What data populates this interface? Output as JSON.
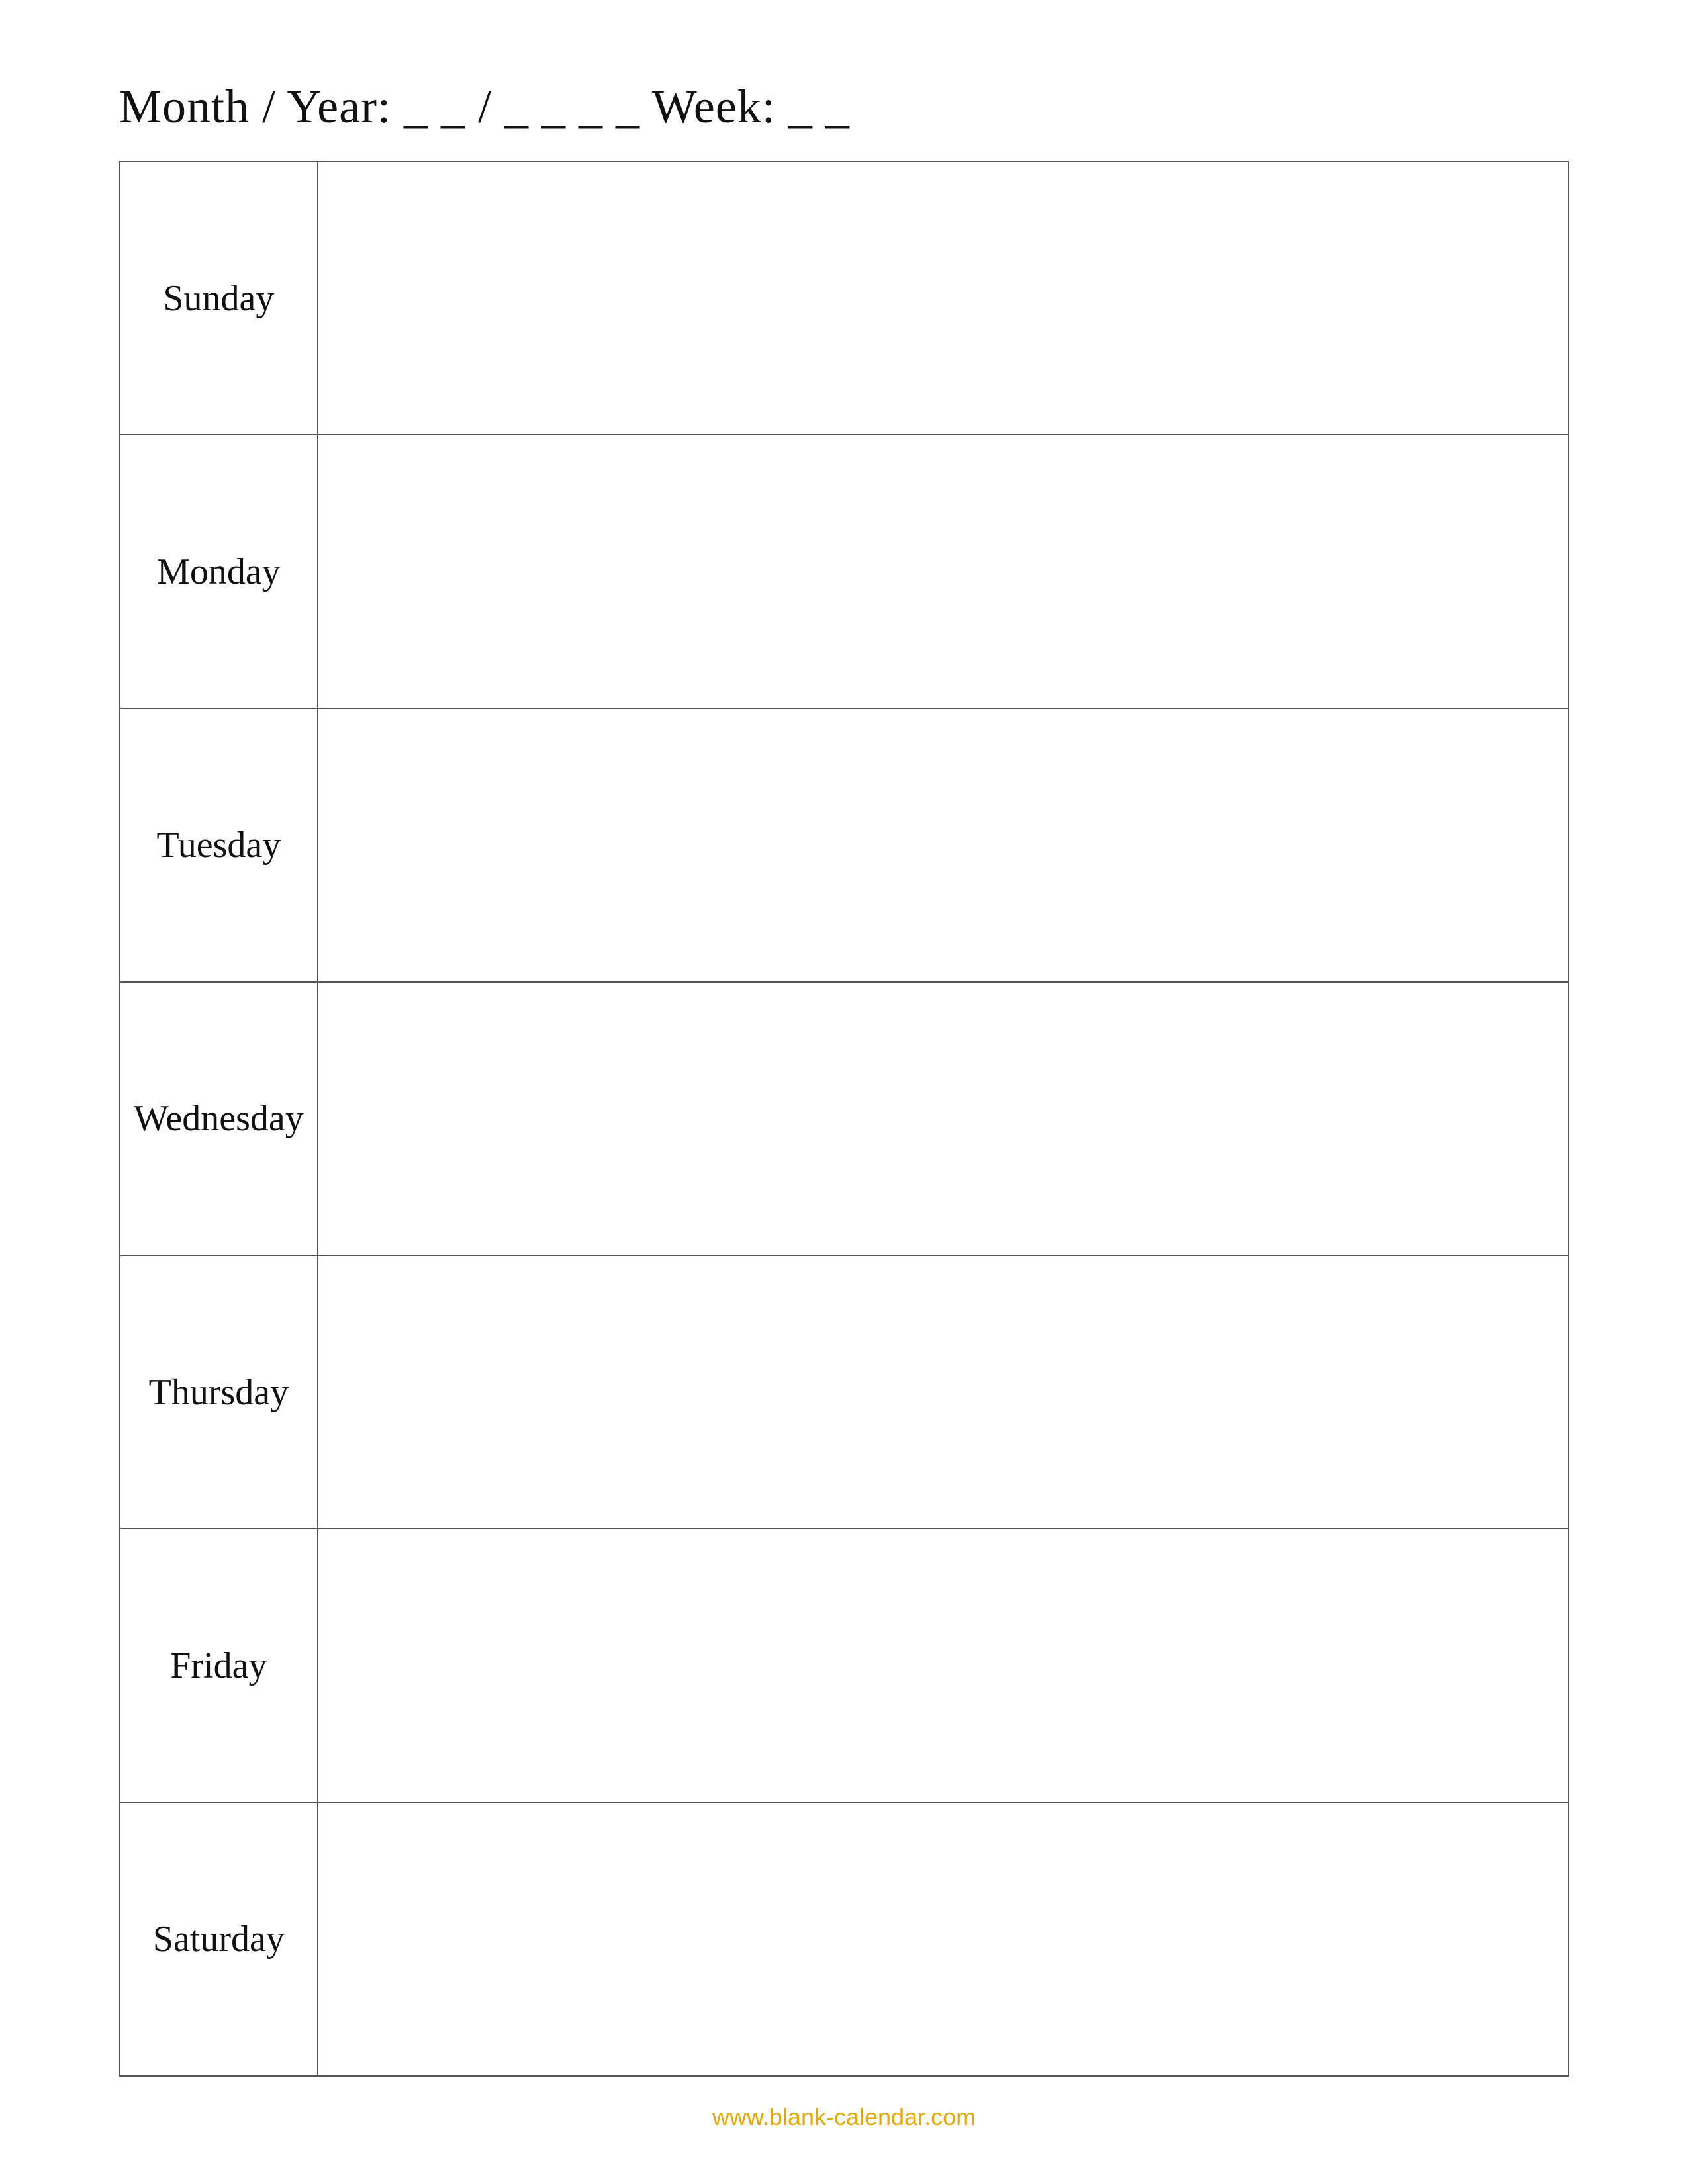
{
  "header": {
    "title": "Month / Year: _ _ / _ _ _ _   Week: _ _"
  },
  "days": [
    {
      "name": "Sunday"
    },
    {
      "name": "Monday"
    },
    {
      "name": "Tuesday"
    },
    {
      "name": "Wednesday"
    },
    {
      "name": "Thursday"
    },
    {
      "name": "Friday"
    },
    {
      "name": "Saturday"
    }
  ],
  "footer": {
    "url": "www.blank-calendar.com"
  }
}
